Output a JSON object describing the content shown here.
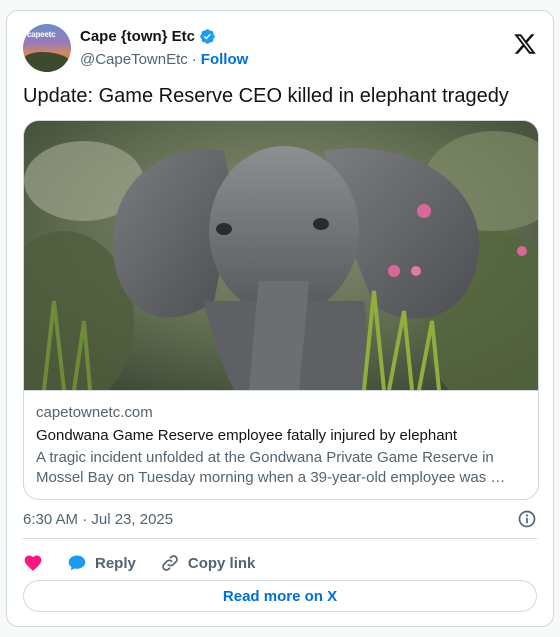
{
  "author": {
    "name": "Cape {town} Etc",
    "handle": "@CapeTownEtc",
    "separator": "·",
    "follow_label": "Follow",
    "avatar_text": "capeetc"
  },
  "tweet": {
    "text": "Update: Game Reserve CEO killed in elephant tragedy"
  },
  "link_card": {
    "domain": "capetownetc.com",
    "title": "Gondwana Game Reserve employee fatally injured by elephant",
    "description": "A tragic incident unfolded at the Gondwana Private Game Reserve in Mossel Bay on Tuesday morning when a 39-year-old employee was …"
  },
  "meta": {
    "timestamp": "6:30 AM · Jul 23, 2025"
  },
  "actions": {
    "reply_label": "Reply",
    "copy_link_label": "Copy link",
    "read_more_label": "Read more on X"
  },
  "colors": {
    "accent": "#006fd6",
    "verified": "#1d9bf0",
    "like": "#f91880"
  },
  "icons": [
    "verified-badge-icon",
    "x-logo-icon",
    "info-icon",
    "heart-icon",
    "reply-bubble-icon",
    "link-icon"
  ]
}
